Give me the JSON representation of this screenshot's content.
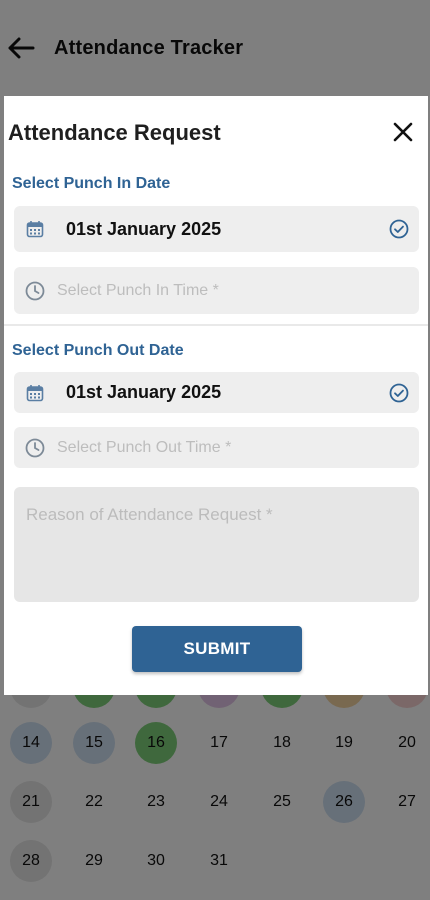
{
  "appbar": {
    "title": "Attendance Tracker",
    "back_icon": "arrow-left-icon"
  },
  "calendar": {
    "row_partial": [
      {
        "label": "",
        "color": "grey"
      },
      {
        "label": "",
        "color": "green"
      },
      {
        "label": "",
        "color": "green"
      },
      {
        "label": "",
        "color": "purple"
      },
      {
        "label": "",
        "color": "green"
      },
      {
        "label": "",
        "color": "orange"
      },
      {
        "label": "",
        "color": "pink"
      }
    ],
    "row1": [
      {
        "label": "14",
        "color": "blue"
      },
      {
        "label": "15",
        "color": "blue"
      },
      {
        "label": "16",
        "color": "green"
      },
      {
        "label": "17",
        "color": "none"
      },
      {
        "label": "18",
        "color": "none"
      },
      {
        "label": "19",
        "color": "none"
      },
      {
        "label": "20",
        "color": "none"
      }
    ],
    "row2": [
      {
        "label": "21",
        "color": "grey"
      },
      {
        "label": "22",
        "color": "none"
      },
      {
        "label": "23",
        "color": "none"
      },
      {
        "label": "24",
        "color": "none"
      },
      {
        "label": "25",
        "color": "none"
      },
      {
        "label": "26",
        "color": "blue"
      },
      {
        "label": "27",
        "color": "none"
      }
    ],
    "row3": [
      {
        "label": "28",
        "color": "grey"
      },
      {
        "label": "29",
        "color": "none"
      },
      {
        "label": "30",
        "color": "none"
      },
      {
        "label": "31",
        "color": "none"
      }
    ]
  },
  "dialog": {
    "title": "Attendance Request",
    "close_icon": "close-icon",
    "punch_in": {
      "section_label": "Select Punch In Date",
      "date_value": "01st January 2025",
      "time_placeholder": "Select Punch In Time *"
    },
    "punch_out": {
      "section_label": "Select Punch Out Date",
      "date_value": "01st January 2025",
      "time_placeholder": "Select Punch Out Time *"
    },
    "reason_placeholder": "Reason of Attendance Request *",
    "submit_label": "SUBMIT"
  },
  "colors": {
    "accent": "#2f6394",
    "field_bg": "#eeeeee",
    "scrim": "rgba(0,0,0,0.5)"
  }
}
